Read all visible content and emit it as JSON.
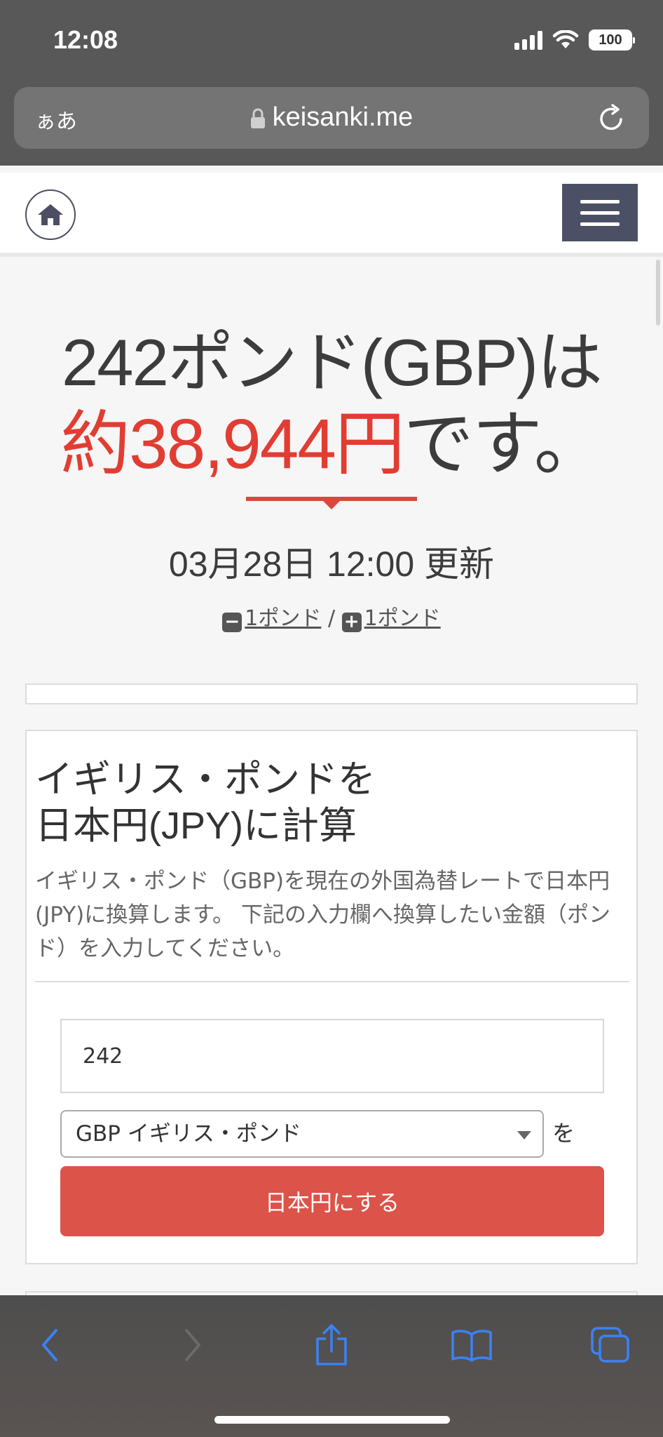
{
  "status_bar": {
    "time": "12:08",
    "battery": "100"
  },
  "browser": {
    "aa_label": "ぁあ",
    "url": "keisanki.me"
  },
  "result": {
    "amount_text": "242ポンド(GBP)は",
    "approx_prefix": "約",
    "yen_value": "38,944",
    "yen_unit": "円",
    "suffix": "です。"
  },
  "updated": "03月28日 12:00 更新",
  "stepper": {
    "minus_label": "1ポンド",
    "separator": "/",
    "plus_label": "1ポンド"
  },
  "converter": {
    "title_line1": "イギリス・ポンドを",
    "title_line2": "日本円(JPY)に計算",
    "description": "イギリス・ポンド（GBP)を現在の外国為替レートで日本円(JPY)に換算します。 下記の入力欄へ換算したい金額（ポンド）を入力してください。",
    "amount_value": "242",
    "currency_selected": "GBP イギリス・ポンド",
    "wo_label": "を",
    "button_label": "日本円にする"
  },
  "colors": {
    "accent_red": "#e13d33",
    "button_red": "#dc5349",
    "nav_dark": "#4c5065",
    "ios_blue": "#3b82f6"
  }
}
